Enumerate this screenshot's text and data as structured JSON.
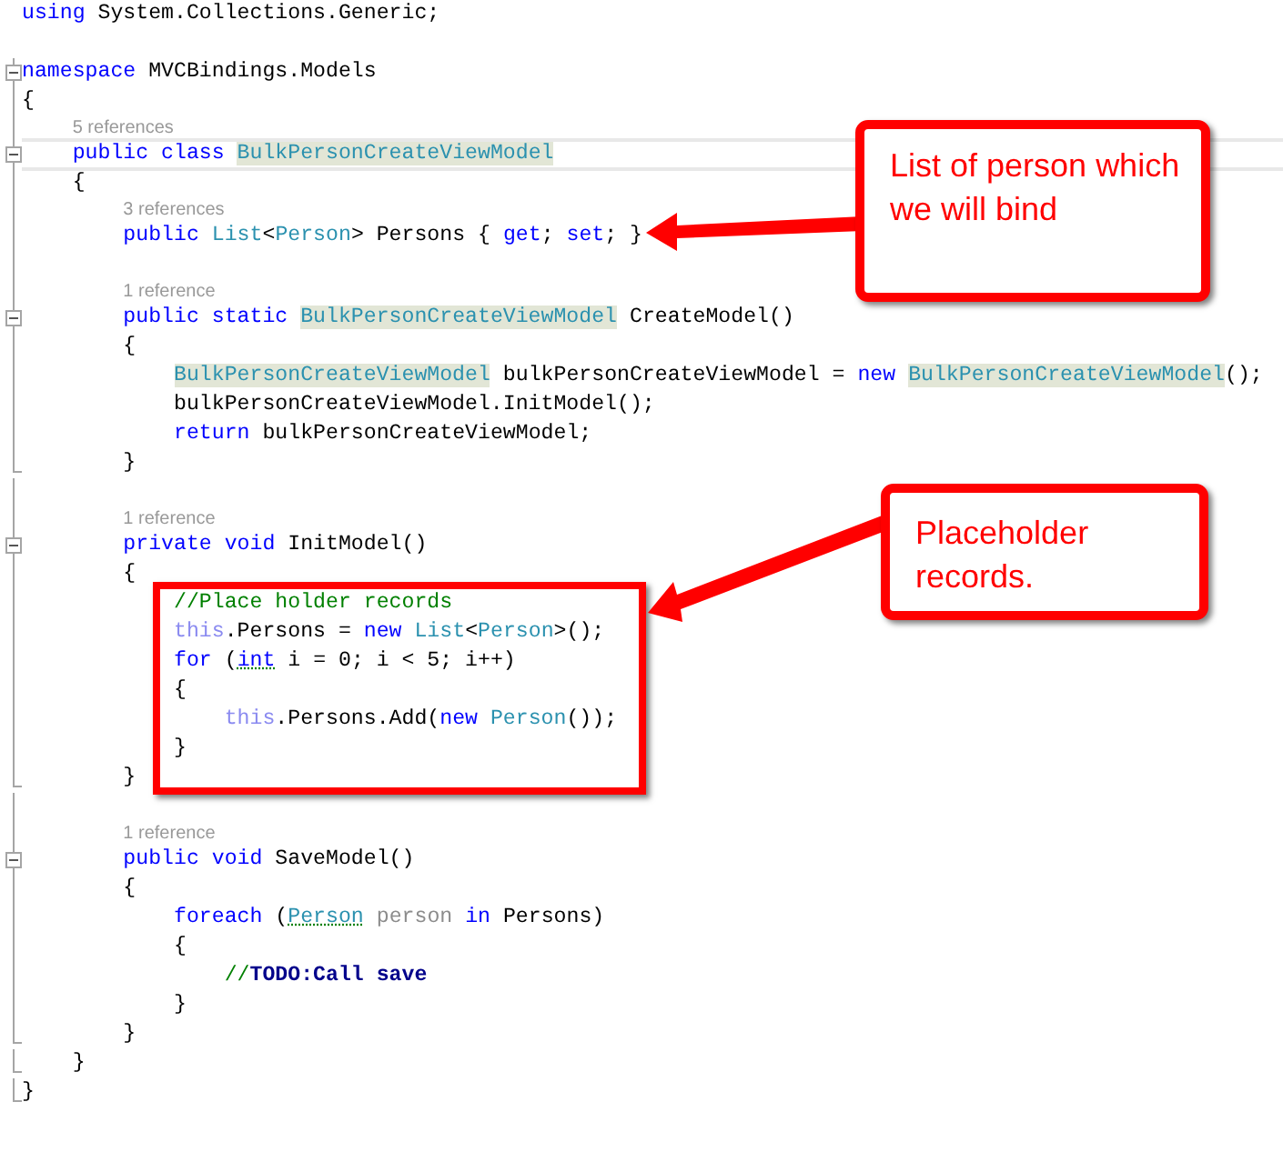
{
  "editor": {
    "lines": [
      {
        "kind": "code",
        "guide": false,
        "tokens": [
          {
            "kind": "kw",
            "text": "using"
          },
          {
            "kind": "plain",
            "text": " System.Collections.Generic;"
          }
        ]
      },
      {
        "kind": "blank",
        "guide": false
      },
      {
        "kind": "code",
        "guide": true,
        "fold": true,
        "tokens": [
          {
            "kind": "kw",
            "text": "namespace"
          },
          {
            "kind": "plain",
            "text": " MVCBindings.Models"
          }
        ]
      },
      {
        "kind": "code",
        "guide": true,
        "tokens": [
          {
            "kind": "plain",
            "text": "{"
          }
        ]
      },
      {
        "kind": "hint",
        "guide": true,
        "tokens": [
          {
            "kind": "hint",
            "text": "    5 references"
          }
        ]
      },
      {
        "kind": "code",
        "guide": true,
        "fold": true,
        "current": true,
        "tokens": [
          {
            "kind": "kw",
            "text": "    public class "
          },
          {
            "kind": "type_hl",
            "text": "BulkPersonCreateViewModel"
          }
        ]
      },
      {
        "kind": "code",
        "guide": true,
        "tokens": [
          {
            "kind": "plain",
            "text": "    {"
          }
        ]
      },
      {
        "kind": "hint",
        "guide": true,
        "tokens": [
          {
            "kind": "hint",
            "text": "        3 references"
          }
        ]
      },
      {
        "kind": "code",
        "guide": true,
        "tokens": [
          {
            "kind": "kw",
            "text": "        public "
          },
          {
            "kind": "type",
            "text": "List"
          },
          {
            "kind": "plain",
            "text": "<"
          },
          {
            "kind": "type",
            "text": "Person"
          },
          {
            "kind": "plain",
            "text": "> Persons { "
          },
          {
            "kind": "kw",
            "text": "get"
          },
          {
            "kind": "plain",
            "text": "; "
          },
          {
            "kind": "kw",
            "text": "set"
          },
          {
            "kind": "plain",
            "text": "; }"
          }
        ]
      },
      {
        "kind": "blank",
        "guide": true
      },
      {
        "kind": "hint",
        "guide": true,
        "tokens": [
          {
            "kind": "hint",
            "text": "        1 reference"
          }
        ]
      },
      {
        "kind": "code",
        "guide": true,
        "fold": true,
        "tokens": [
          {
            "kind": "kw",
            "text": "        public static "
          },
          {
            "kind": "type_hl",
            "text": "BulkPersonCreateViewModel"
          },
          {
            "kind": "plain",
            "text": " CreateModel()"
          }
        ]
      },
      {
        "kind": "code",
        "guide": true,
        "tokens": [
          {
            "kind": "plain",
            "text": "        {"
          }
        ]
      },
      {
        "kind": "code",
        "guide": true,
        "tokens": [
          {
            "kind": "type_hl",
            "text": "            BulkPersonCreateViewModel"
          },
          {
            "kind": "plain",
            "text": " bulkPersonCreateViewModel = "
          },
          {
            "kind": "kw",
            "text": "new "
          },
          {
            "kind": "type_hl",
            "text": "BulkPersonCreateViewModel"
          },
          {
            "kind": "plain",
            "text": "();"
          }
        ]
      },
      {
        "kind": "code",
        "guide": true,
        "tokens": [
          {
            "kind": "plain",
            "text": "            bulkPersonCreateViewModel.InitModel();"
          }
        ]
      },
      {
        "kind": "code",
        "guide": true,
        "tokens": [
          {
            "kind": "kw",
            "text": "            return"
          },
          {
            "kind": "plain",
            "text": " bulkPersonCreateViewModel;"
          }
        ]
      },
      {
        "kind": "code",
        "guide": true,
        "block_end": true,
        "tokens": [
          {
            "kind": "plain",
            "text": "        }"
          }
        ]
      },
      {
        "kind": "blank",
        "guide": true
      },
      {
        "kind": "hint",
        "guide": true,
        "tokens": [
          {
            "kind": "hint",
            "text": "        1 reference"
          }
        ]
      },
      {
        "kind": "code",
        "guide": true,
        "fold": true,
        "tokens": [
          {
            "kind": "kw",
            "text": "        private void"
          },
          {
            "kind": "plain",
            "text": " InitModel()"
          }
        ]
      },
      {
        "kind": "code",
        "guide": true,
        "tokens": [
          {
            "kind": "plain",
            "text": "        {"
          }
        ]
      },
      {
        "kind": "code",
        "guide": true,
        "tokens": [
          {
            "kind": "comment",
            "text": "            //Place holder records"
          }
        ]
      },
      {
        "kind": "code",
        "guide": true,
        "tokens": [
          {
            "kind": "this",
            "text": "            this"
          },
          {
            "kind": "plain",
            "text": ".Persons = "
          },
          {
            "kind": "kw",
            "text": "new "
          },
          {
            "kind": "type",
            "text": "List"
          },
          {
            "kind": "plain",
            "text": "<"
          },
          {
            "kind": "type",
            "text": "Person"
          },
          {
            "kind": "plain",
            "text": ">();"
          }
        ]
      },
      {
        "kind": "code",
        "guide": true,
        "tokens": [
          {
            "kind": "kw",
            "text": "            for"
          },
          {
            "kind": "plain",
            "text": " ("
          },
          {
            "kind": "kw",
            "text": "int",
            "squiggle": true
          },
          {
            "kind": "plain",
            "text": " i = 0; i < 5; i++)"
          }
        ]
      },
      {
        "kind": "code",
        "guide": true,
        "tokens": [
          {
            "kind": "plain",
            "text": "            {"
          }
        ]
      },
      {
        "kind": "code",
        "guide": true,
        "tokens": [
          {
            "kind": "this",
            "text": "                this"
          },
          {
            "kind": "plain",
            "text": ".Persons.Add("
          },
          {
            "kind": "kw",
            "text": "new "
          },
          {
            "kind": "type",
            "text": "Person"
          },
          {
            "kind": "plain",
            "text": "());"
          }
        ]
      },
      {
        "kind": "code",
        "guide": true,
        "tokens": [
          {
            "kind": "plain",
            "text": "            }"
          }
        ]
      },
      {
        "kind": "code",
        "guide": true,
        "block_end": true,
        "tokens": [
          {
            "kind": "plain",
            "text": "        }"
          }
        ]
      },
      {
        "kind": "blank",
        "guide": true
      },
      {
        "kind": "hint",
        "guide": true,
        "tokens": [
          {
            "kind": "hint",
            "text": "        1 reference"
          }
        ]
      },
      {
        "kind": "code",
        "guide": true,
        "fold": true,
        "tokens": [
          {
            "kind": "kw",
            "text": "        public void"
          },
          {
            "kind": "plain",
            "text": " SaveModel()"
          }
        ]
      },
      {
        "kind": "code",
        "guide": true,
        "tokens": [
          {
            "kind": "plain",
            "text": "        {"
          }
        ]
      },
      {
        "kind": "code",
        "guide": true,
        "tokens": [
          {
            "kind": "kw",
            "text": "            foreach"
          },
          {
            "kind": "plain",
            "text": " ("
          },
          {
            "kind": "type",
            "text": "Person",
            "squiggle": true
          },
          {
            "kind": "unused",
            "text": " person"
          },
          {
            "kind": "kw",
            "text": " in"
          },
          {
            "kind": "plain",
            "text": " Persons)"
          }
        ]
      },
      {
        "kind": "code",
        "guide": true,
        "tokens": [
          {
            "kind": "plain",
            "text": "            {"
          }
        ]
      },
      {
        "kind": "code",
        "guide": true,
        "tokens": [
          {
            "kind": "comment",
            "text": "                //"
          },
          {
            "kind": "todo",
            "text": "TODO:Call save"
          }
        ]
      },
      {
        "kind": "code",
        "guide": true,
        "tokens": [
          {
            "kind": "plain",
            "text": "            }"
          }
        ]
      },
      {
        "kind": "code",
        "guide": true,
        "block_end": true,
        "tokens": [
          {
            "kind": "plain",
            "text": "        }"
          }
        ]
      },
      {
        "kind": "code",
        "guide": true,
        "block_end": true,
        "tokens": [
          {
            "kind": "plain",
            "text": "    }"
          }
        ]
      },
      {
        "kind": "code",
        "guide": true,
        "block_end": true,
        "tokens": [
          {
            "kind": "plain",
            "text": "}"
          }
        ]
      }
    ]
  },
  "annotations": [
    {
      "text": "List of person which we will bind"
    },
    {
      "text": "Placeholder records."
    }
  ]
}
